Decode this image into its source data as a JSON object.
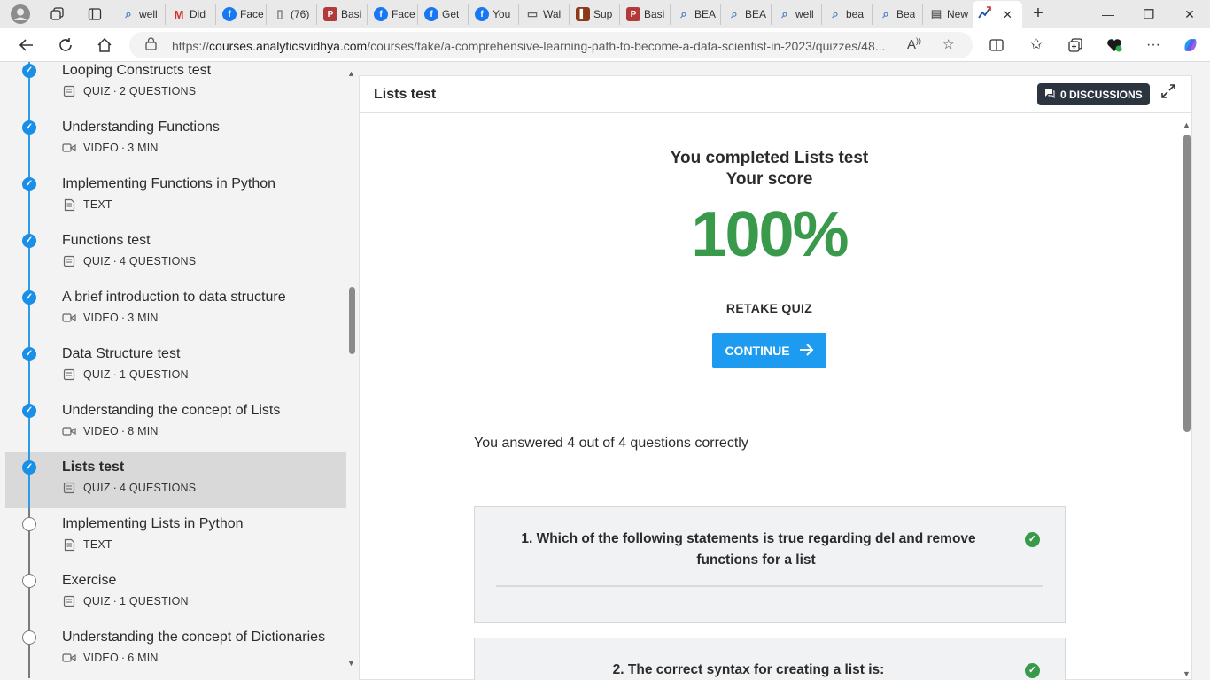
{
  "browser": {
    "tabs": [
      {
        "label": "well",
        "icon": "search-icon",
        "color": "#4a7fc1"
      },
      {
        "label": "Did",
        "icon": "gmail-icon",
        "color": "#d93025"
      },
      {
        "label": "Face",
        "icon": "facebook-icon",
        "color": "#1877f2"
      },
      {
        "label": "(76)",
        "icon": "page-icon",
        "color": "#777777"
      },
      {
        "label": "Basi",
        "icon": "pdf-icon",
        "color": "#b33a3a"
      },
      {
        "label": "Face",
        "icon": "facebook-icon",
        "color": "#1877f2"
      },
      {
        "label": "Get",
        "icon": "facebook-icon",
        "color": "#1877f2"
      },
      {
        "label": "You",
        "icon": "facebook-icon",
        "color": "#1877f2"
      },
      {
        "label": "Wal",
        "icon": "wallet-icon",
        "color": "#666666"
      },
      {
        "label": "Sup",
        "icon": "sup-icon",
        "color": "#8b3a1a"
      },
      {
        "label": "Basi",
        "icon": "pdf-icon",
        "color": "#b33a3a"
      },
      {
        "label": "BEA",
        "icon": "search-icon",
        "color": "#4a7fc1"
      },
      {
        "label": "BEA",
        "icon": "search-icon",
        "color": "#4a7fc1"
      },
      {
        "label": "well",
        "icon": "search-icon",
        "color": "#4a7fc1"
      },
      {
        "label": "bea",
        "icon": "search-icon",
        "color": "#4a7fc1"
      },
      {
        "label": "Bea",
        "icon": "search-icon",
        "color": "#4a7fc1"
      },
      {
        "label": "New",
        "icon": "newtab-icon",
        "color": "#666666"
      }
    ],
    "url_prefix": "https://",
    "url_host": "courses.analyticsvidhya.com",
    "url_path": "/courses/take/a-comprehensive-learning-path-to-become-a-data-scientist-in-2023/quizzes/48..."
  },
  "sidebar": {
    "lessons": [
      {
        "title": "Looping Constructs test",
        "type": "QUIZ",
        "detail": "2 QUESTIONS",
        "done": true
      },
      {
        "title": "Understanding Functions",
        "type": "VIDEO",
        "detail": "3 MIN",
        "done": true
      },
      {
        "title": "Implementing Functions in Python",
        "type": "TEXT",
        "detail": "",
        "done": true
      },
      {
        "title": "Functions test",
        "type": "QUIZ",
        "detail": "4 QUESTIONS",
        "done": true
      },
      {
        "title": "A brief introduction to data structure",
        "type": "VIDEO",
        "detail": "3 MIN",
        "done": true
      },
      {
        "title": "Data Structure test",
        "type": "QUIZ",
        "detail": "1 QUESTION",
        "done": true
      },
      {
        "title": "Understanding the concept of Lists",
        "type": "VIDEO",
        "detail": "8 MIN",
        "done": true
      },
      {
        "title": "Lists test",
        "type": "QUIZ",
        "detail": "4 QUESTIONS",
        "done": true,
        "current": true
      },
      {
        "title": "Implementing Lists in Python",
        "type": "TEXT",
        "detail": "",
        "done": false
      },
      {
        "title": "Exercise",
        "type": "QUIZ",
        "detail": "1 QUESTION",
        "done": false
      },
      {
        "title": "Understanding the concept of Dictionaries",
        "type": "VIDEO",
        "detail": "6 MIN",
        "done": false
      }
    ]
  },
  "panel": {
    "title": "Lists test",
    "discussions_label": "0 DISCUSSIONS",
    "completed_text": "You completed Lists test",
    "score_label": "Your score",
    "score": "100%",
    "retake_label": "RETAKE QUIZ",
    "continue_label": "CONTINUE",
    "answered_text": "You answered 4 out of 4 questions correctly",
    "questions": [
      {
        "number": "1.",
        "text": "Which of the following statements is true regarding del and remove functions for a list",
        "correct": true
      },
      {
        "number": "2.",
        "text": "The correct syntax for creating a list is:",
        "correct": true
      }
    ]
  },
  "colors": {
    "accent": "#1d9bf0",
    "progress_done": "#1a8fe8",
    "correct": "#3a9a4c",
    "discussion_bg": "#2c3440"
  }
}
